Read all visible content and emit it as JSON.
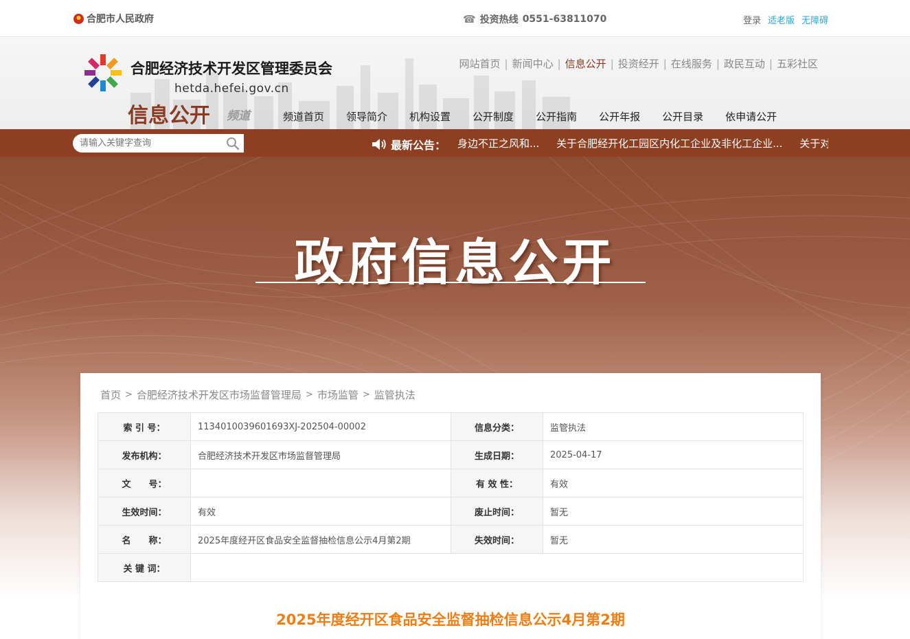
{
  "topbar": {
    "gov_link": "合肥市人民政府",
    "hotline_label": "投资热线",
    "hotline_number": "0551-63811070",
    "login": "登录",
    "elderly": "适老版",
    "accessible": "无障碍"
  },
  "header": {
    "org_name": "合肥经济技术开发区管理委员会",
    "domain": "hetda.hefei.gov.cn",
    "channel_title": "信息公开",
    "channel_sub": "频道",
    "main_nav": [
      {
        "label": "网站首页",
        "active": false
      },
      {
        "label": "新闻中心",
        "active": false
      },
      {
        "label": "信息公开",
        "active": true
      },
      {
        "label": "投资经开",
        "active": false
      },
      {
        "label": "在线服务",
        "active": false
      },
      {
        "label": "政民互动",
        "active": false
      },
      {
        "label": "五彩社区",
        "active": false
      }
    ],
    "sub_nav": [
      "频道首页",
      "领导简介",
      "机构设置",
      "公开制度",
      "公开指南",
      "公开年报",
      "公开目录",
      "依申请公开"
    ]
  },
  "search": {
    "placeholder": "请输入关键字查询"
  },
  "notice": {
    "label": "最新公告：",
    "items": [
      "身边不正之风和...",
      "关于合肥经开化工园区内化工企业及非化工企业...",
      "关于对"
    ]
  },
  "banner": {
    "title": "政府信息公开"
  },
  "breadcrumb": [
    "首页",
    "合肥经济技术开发区市场监督管理局",
    "市场监管",
    "监管执法"
  ],
  "info": {
    "index_no_label": "索 引 号：",
    "index_no": "1134010039601693XJ-202504-00002",
    "category_label": "信息分类：",
    "category": "监管执法",
    "publisher_label": "发布机构：",
    "publisher": "合肥经济技术开发区市场监督管理局",
    "date_label": "生成日期：",
    "date": "2025-04-17",
    "doc_no_label": "文　　号：",
    "doc_no": "",
    "validity_label": "有 效 性：",
    "validity": "有效",
    "effective_label": "生效时间：",
    "effective": "有效",
    "repeal_label": "废止时间：",
    "repeal": "暂无",
    "name_label": "名　　称：",
    "name": "2025年度经开区食品安全监督抽检信息公示4月第2期",
    "expire_label": "失效时间：",
    "expire": "暂无",
    "keywords_label": "关 键 词：",
    "keywords": ""
  },
  "article": {
    "title": "2025年度经开区食品安全监督抽检信息公示4月第2期"
  },
  "colors": {
    "brand": "#8e3f22",
    "accent_orange": "#f07d12",
    "link_blue": "#2aa7d8"
  }
}
